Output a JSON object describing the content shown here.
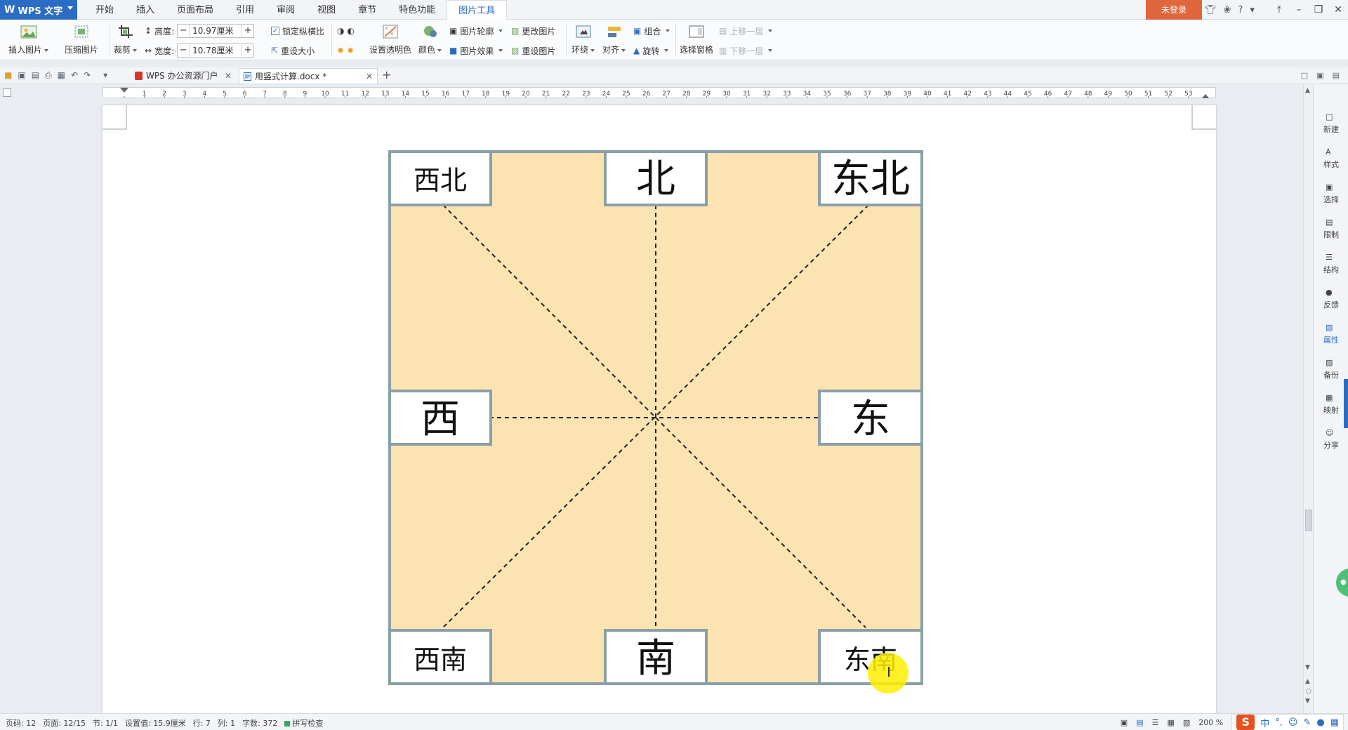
{
  "app": {
    "name": "WPS 文字",
    "logo_letter": "W",
    "login_label": "未登录"
  },
  "menu": {
    "items": [
      "开始",
      "插入",
      "页面布局",
      "引用",
      "审阅",
      "视图",
      "章节",
      "特色功能",
      "图片工具"
    ],
    "active": "图片工具"
  },
  "ribbon": {
    "insert_picture": "插入图片",
    "compress_picture": "压缩图片",
    "crop": "裁剪",
    "height_label": "高度:",
    "height_value": "10.97厘米",
    "width_label": "宽度:",
    "width_value": "10.78厘米",
    "lock_ratio": "锁定纵横比",
    "reset_size": "重设大小",
    "set_transparent": "设置透明色",
    "color": "颜色",
    "picture_outline": "图片轮廓",
    "picture_effects": "图片效果",
    "change_picture": "更改图片",
    "reset_picture": "重设图片",
    "wrap": "环绕",
    "align": "对齐",
    "group": "组合",
    "rotate": "旋转",
    "selection_pane": "选择窗格",
    "bring_forward": "上移一层",
    "send_backward": "下移一层"
  },
  "doc_tabs": [
    {
      "label": "WPS 办公资源门户",
      "active": false
    },
    {
      "label": "用竖式计算.docx *",
      "active": true
    }
  ],
  "ruler": {
    "numbers": [
      "1",
      "2",
      "3",
      "4",
      "5",
      "6",
      "7",
      "8",
      "9",
      "10",
      "11",
      "12",
      "13",
      "14",
      "15",
      "16",
      "17",
      "18",
      "19",
      "20",
      "21",
      "22",
      "23",
      "24",
      "25",
      "26",
      "27",
      "28",
      "29",
      "30",
      "31",
      "32",
      "33",
      "34",
      "35",
      "36",
      "37",
      "38",
      "39",
      "40",
      "41",
      "42",
      "43",
      "44",
      "45",
      "46",
      "47",
      "48",
      "49",
      "50",
      "51",
      "52",
      "53"
    ]
  },
  "compass": {
    "northwest": "西北",
    "north": "北",
    "northeast": "东北",
    "west": "西",
    "east": "东",
    "southwest": "西南",
    "south": "南",
    "southeast": "东南",
    "fill_color": "#fce4b2",
    "border_color": "#8aa0a8"
  },
  "sidepanel": {
    "items": [
      "新建",
      "样式",
      "选择",
      "限制",
      "结构",
      "反馈",
      "属性",
      "备份",
      "映射",
      "分享"
    ]
  },
  "status": {
    "page_no": "页码: 12",
    "page": "页面: 12/15",
    "section": "节: 1/1",
    "setting": "设置值: 15.9厘米",
    "row": "行: 7",
    "col": "列: 1",
    "words": "字数: 372",
    "spell": "拼写检查",
    "zoom": "200 %"
  },
  "ime": {
    "logo": "S",
    "mode": "中"
  }
}
